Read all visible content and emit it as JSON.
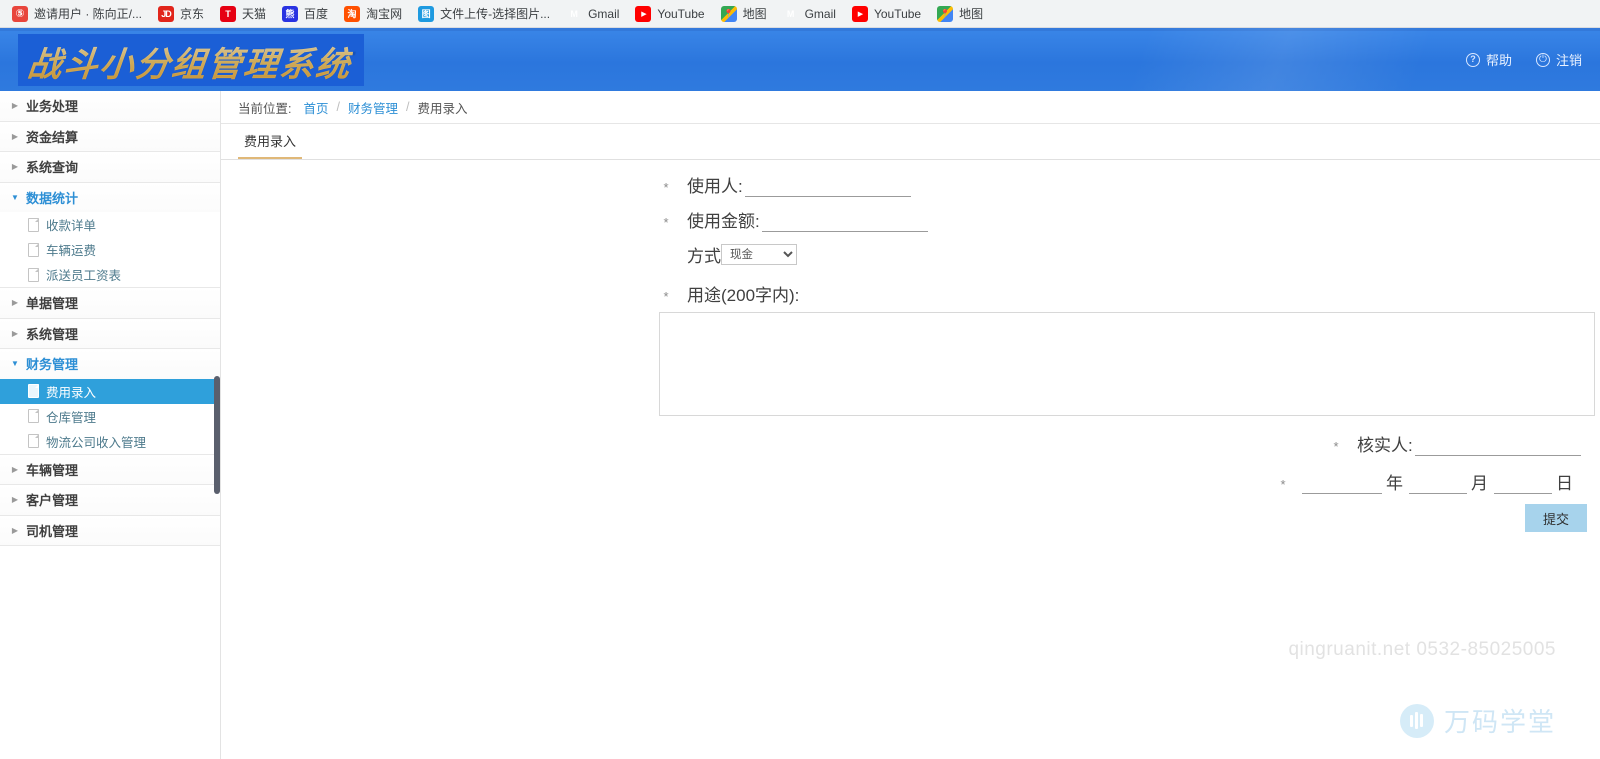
{
  "browser": {
    "bookmarks": [
      {
        "label": "邀请用户 · 陈向正/...",
        "icon": "invite-icon",
        "fav": "fav-invite"
      },
      {
        "label": "京东",
        "icon": "jd-icon",
        "fav": "fav-jd"
      },
      {
        "label": "天猫",
        "icon": "tmall-icon",
        "fav": "fav-tmall"
      },
      {
        "label": "百度",
        "icon": "baidu-icon",
        "fav": "fav-baidu"
      },
      {
        "label": "淘宝网",
        "icon": "taobao-icon",
        "fav": "fav-taobao"
      },
      {
        "label": "文件上传-选择图片...",
        "icon": "upload-icon",
        "fav": "fav-upload"
      },
      {
        "label": "Gmail",
        "icon": "gmail-icon",
        "fav": "fav-gmail"
      },
      {
        "label": "YouTube",
        "icon": "youtube-icon",
        "fav": "fav-yt"
      },
      {
        "label": "地图",
        "icon": "maps-icon",
        "fav": "fav-maps"
      },
      {
        "label": "Gmail",
        "icon": "gmail-icon",
        "fav": "fav-gmail"
      },
      {
        "label": "YouTube",
        "icon": "youtube-icon",
        "fav": "fav-yt"
      },
      {
        "label": "地图",
        "icon": "maps-icon",
        "fav": "fav-maps"
      }
    ]
  },
  "header": {
    "logo_text": "战斗小分组管理系统",
    "help_label": "帮助",
    "logout_label": "注销",
    "help_icon": "question-circle-icon",
    "logout_icon": "power-icon",
    "bg_color": "#2b76dd",
    "logo_color": "#f3c96a"
  },
  "sidebar": {
    "active_color": "#2fa0db",
    "groups": [
      {
        "label": "业务处理",
        "expanded": false,
        "children": []
      },
      {
        "label": "资金结算",
        "expanded": false,
        "children": []
      },
      {
        "label": "系统查询",
        "expanded": false,
        "children": []
      },
      {
        "label": "数据统计",
        "expanded": true,
        "children": [
          {
            "label": "收款详单",
            "active": false
          },
          {
            "label": "车辆运费",
            "active": false
          },
          {
            "label": "派送员工资表",
            "active": false
          }
        ]
      },
      {
        "label": "单据管理",
        "expanded": false,
        "children": []
      },
      {
        "label": "系统管理",
        "expanded": false,
        "children": []
      },
      {
        "label": "财务管理",
        "expanded": true,
        "children": [
          {
            "label": "费用录入",
            "active": true
          },
          {
            "label": "仓库管理",
            "active": false
          },
          {
            "label": "物流公司收入管理",
            "active": false
          }
        ]
      },
      {
        "label": "车辆管理",
        "expanded": false,
        "children": []
      },
      {
        "label": "客户管理",
        "expanded": false,
        "children": []
      },
      {
        "label": "司机管理",
        "expanded": false,
        "children": []
      }
    ]
  },
  "breadcrumb": {
    "prefix": "当前位置:",
    "home": "首页",
    "separator": "/",
    "section": "财务管理",
    "current": "费用录入"
  },
  "tab": {
    "label": "费用录入",
    "underline_color": "#e0b878"
  },
  "form": {
    "user_star": "*",
    "user_label": "使用人:",
    "user_value": "",
    "amount_star": "*",
    "amount_label": "使用金额:",
    "amount_value": "",
    "method_label": "方式",
    "method_selected": "现金",
    "method_options": [
      "现金"
    ],
    "purpose_star": "*",
    "purpose_label": "用途(200字内):",
    "purpose_value": "",
    "verifier_star": "*",
    "verifier_label": "核实人:",
    "verifier_value": "",
    "date_star": "*",
    "date_year_value": "",
    "date_year_label": "年",
    "date_month_value": "",
    "date_month_label": "月",
    "date_day_value": "",
    "date_day_label": "日",
    "submit_label": "提交",
    "submit_color": "#a7d3ec"
  },
  "watermark": {
    "contact": "qingruanit.net 0532-85025005",
    "brand": "万码学堂"
  }
}
